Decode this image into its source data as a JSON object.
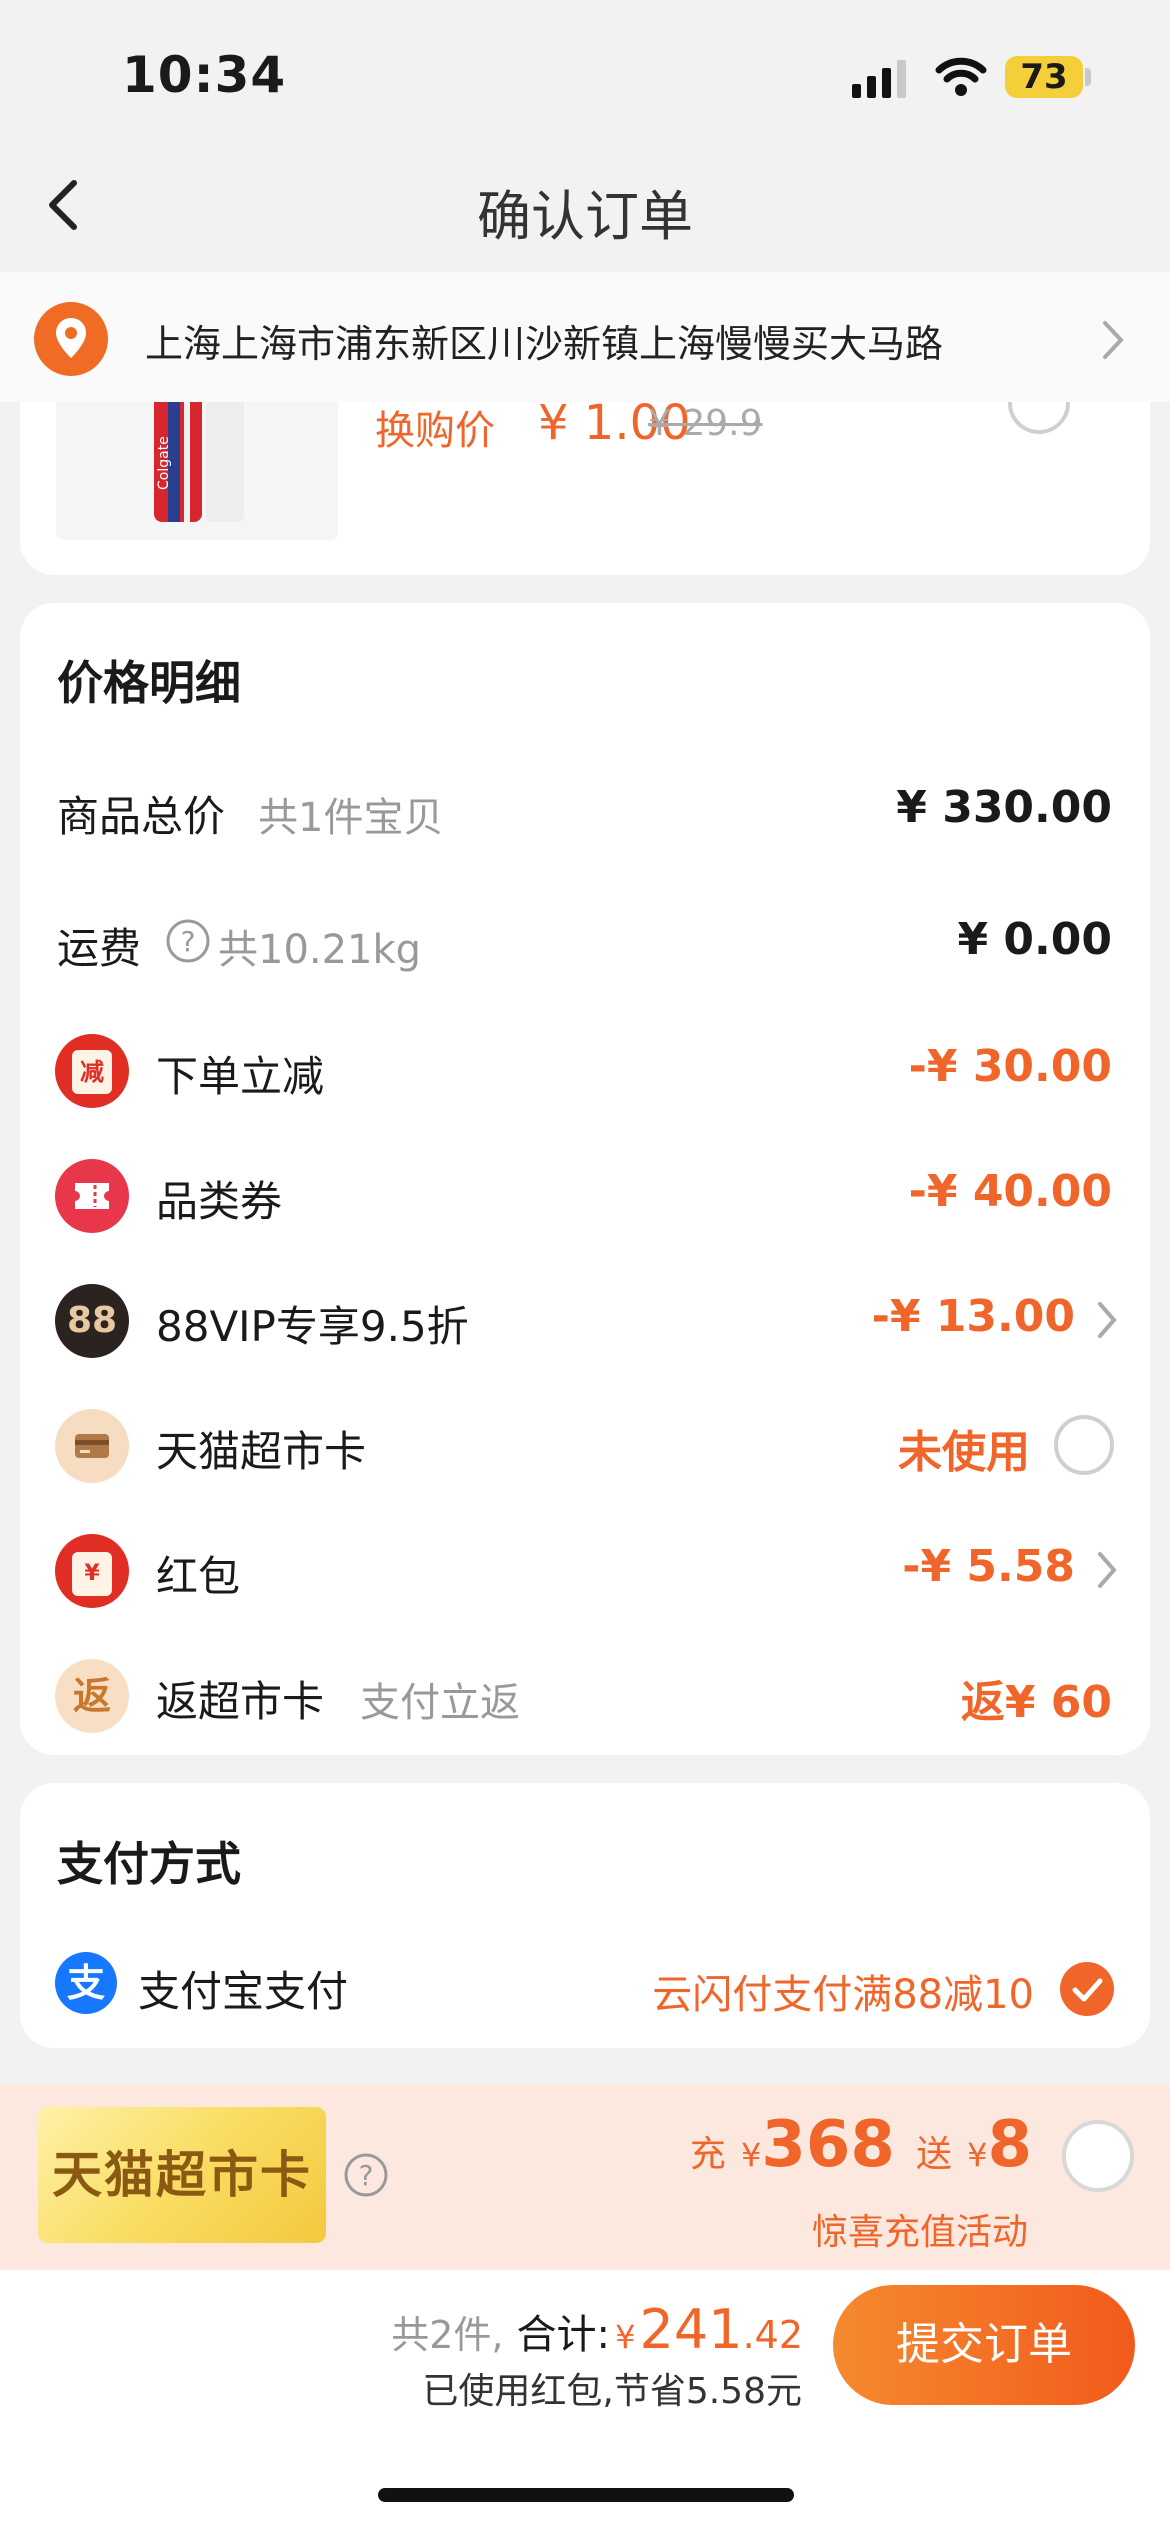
{
  "status_bar": {
    "time": "10:34",
    "battery": "73"
  },
  "nav": {
    "title": "确认订单"
  },
  "address": {
    "text": "上海上海市浦东新区川沙新镇上海慢慢买大马路"
  },
  "exchange_item": {
    "label": "换购价",
    "price": "¥ 1.00",
    "original_price": "¥ 29.9"
  },
  "price_detail": {
    "title": "价格明细",
    "rows": [
      {
        "label": "商品总价",
        "sub": "共1件宝贝",
        "value": "¥ 330.00"
      },
      {
        "label": "运费",
        "sub": "共10.21kg",
        "value": "¥ 0.00"
      },
      {
        "label": "下单立减",
        "icon": "减",
        "value": "-¥ 30.00"
      },
      {
        "label": "品类券",
        "icon": "coupon-icon",
        "value": "-¥ 40.00"
      },
      {
        "label": "88VIP专享9.5折",
        "icon": "88",
        "value": "-¥ 13.00"
      },
      {
        "label": "天猫超市卡",
        "icon": "card-icon",
        "value": "未使用"
      },
      {
        "label": "红包",
        "icon": "¥",
        "value": "-¥ 5.58"
      },
      {
        "label": "返超市卡",
        "sub": "支付立返",
        "icon": "返",
        "value": "返¥ 60"
      }
    ]
  },
  "payment": {
    "title": "支付方式",
    "method": "支付宝支付",
    "promo": "云闪付支付满88减10"
  },
  "promo_bar": {
    "badge": "天猫超市卡",
    "charge_label": "充",
    "currency": "¥",
    "charge_amount": "368",
    "gift_label": "送",
    "gift_amount": "8",
    "subtitle": "惊喜充值活动"
  },
  "checkout": {
    "count": "共2件,",
    "total_label": "合计:",
    "currency": "¥",
    "total_int": "241",
    "total_dec": ".42",
    "saving": "已使用红包,节省5.58元",
    "submit": "提交订单"
  },
  "colors": {
    "accent": "#f0652a",
    "alipay": "#1677ff",
    "red_icon": "#e02e24"
  }
}
